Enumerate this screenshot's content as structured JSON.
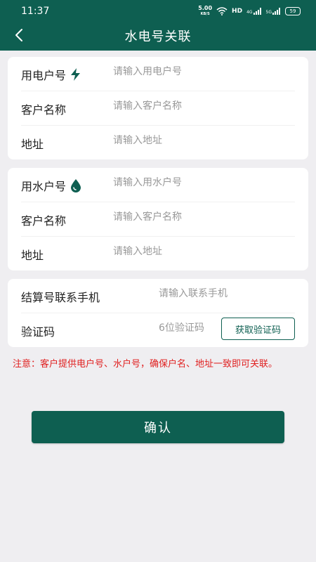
{
  "status_bar": {
    "time": "11:37",
    "net_speed_value": "5.00",
    "net_speed_unit": "KB/S",
    "hd_label": "HD",
    "signal_4g": "4G",
    "signal_5g": "5G",
    "battery": "59"
  },
  "nav": {
    "title": "水电号关联"
  },
  "electric_card": {
    "account_label": "用电户号",
    "account_placeholder": "请输入用电户号",
    "name_label": "客户名称",
    "name_placeholder": "请输入客户名称",
    "address_label": "地址",
    "address_placeholder": "请输入地址"
  },
  "water_card": {
    "account_label": "用水户号",
    "account_placeholder": "请输入用水户号",
    "name_label": "客户名称",
    "name_placeholder": "请输入客户名称",
    "address_label": "地址",
    "address_placeholder": "请输入地址"
  },
  "contact_card": {
    "phone_label": "结算号联系手机",
    "phone_placeholder": "请输入联系手机",
    "code_label": "验证码",
    "code_placeholder": "6位验证码",
    "get_code_label": "获取验证码"
  },
  "note": "注意：客户提供电户号、水户号，确保户名、地址一致即可关联。",
  "confirm_label": "确认",
  "colors": {
    "primary": "#0e5f51",
    "background": "#efeef1",
    "warning": "#e02020"
  }
}
